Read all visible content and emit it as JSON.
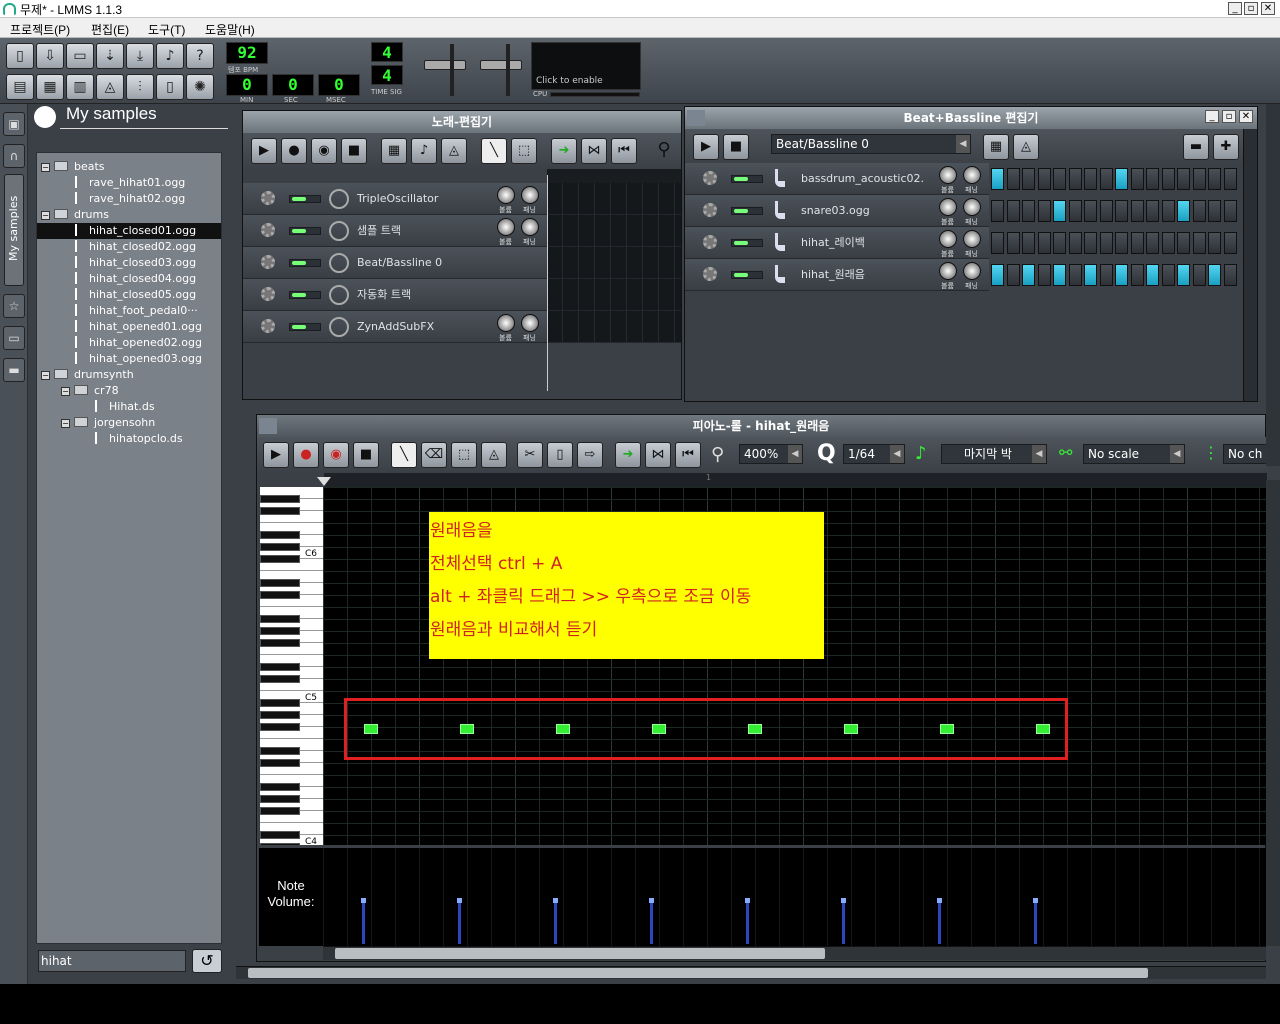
{
  "window": {
    "title": "무제* - LMMS 1.1.3",
    "min": "_",
    "max": "▫",
    "close": "✕"
  },
  "menu": [
    "프로젝트(P)",
    "편집(E)",
    "도구(T)",
    "도움말(H)"
  ],
  "toolbar": {
    "tempo": "92",
    "tempo_label": "템포 BPM",
    "min": "0",
    "sec": "0",
    "msec": "0",
    "min_label": "MIN",
    "sec_label": "SEC",
    "msec_label": "MSEC",
    "sig_num": "4",
    "sig_den": "4",
    "sig_label": "TIME SIG",
    "cpu_hint": "Click to enable",
    "cpu_label": "CPU"
  },
  "browser": {
    "title": "My samples",
    "side_tab_label": "My samples",
    "search_value": "hihat",
    "tree": [
      {
        "label": "beats",
        "type": "folder",
        "depth": 0
      },
      {
        "label": "rave_hihat01.ogg",
        "type": "file",
        "depth": 1
      },
      {
        "label": "rave_hihat02.ogg",
        "type": "file",
        "depth": 1
      },
      {
        "label": "drums",
        "type": "folder",
        "depth": 0
      },
      {
        "label": "hihat_closed01.ogg",
        "type": "file",
        "depth": 1,
        "selected": true
      },
      {
        "label": "hihat_closed02.ogg",
        "type": "file",
        "depth": 1
      },
      {
        "label": "hihat_closed03.ogg",
        "type": "file",
        "depth": 1
      },
      {
        "label": "hihat_closed04.ogg",
        "type": "file",
        "depth": 1
      },
      {
        "label": "hihat_closed05.ogg",
        "type": "file",
        "depth": 1
      },
      {
        "label": "hihat_foot_pedal0···",
        "type": "file",
        "depth": 1
      },
      {
        "label": "hihat_opened01.ogg",
        "type": "file",
        "depth": 1
      },
      {
        "label": "hihat_opened02.ogg",
        "type": "file",
        "depth": 1
      },
      {
        "label": "hihat_opened03.ogg",
        "type": "file",
        "depth": 1
      },
      {
        "label": "drumsynth",
        "type": "folder",
        "depth": 0
      },
      {
        "label": "cr78",
        "type": "folder",
        "depth": 1
      },
      {
        "label": "Hihat.ds",
        "type": "file",
        "depth": 2
      },
      {
        "label": "jorgensohn",
        "type": "folder",
        "depth": 1
      },
      {
        "label": "hihatopclo.ds",
        "type": "file",
        "depth": 2
      }
    ]
  },
  "song_editor": {
    "title": "노래-편집기",
    "tracks": [
      {
        "name": "TripleOscillator",
        "knobs": true
      },
      {
        "name": "샘플 트랙",
        "knobs": true
      },
      {
        "name": "Beat/Bassline 0",
        "knobs": false
      },
      {
        "name": "자동화 트랙",
        "knobs": false
      },
      {
        "name": "ZynAddSubFX",
        "knobs": true
      }
    ],
    "knob_labels": [
      "볼륨",
      "패닝"
    ]
  },
  "bb_editor": {
    "title": "Beat+Bassline 편집기",
    "selector": "Beat/Bassline 0",
    "tracks": [
      {
        "name": "bassdrum_acoustic02.",
        "steps": [
          1,
          0,
          0,
          0,
          0,
          0,
          0,
          0,
          1,
          0,
          0,
          0,
          0,
          0,
          0,
          0
        ]
      },
      {
        "name": "snare03.ogg",
        "steps": [
          0,
          0,
          0,
          0,
          1,
          0,
          0,
          0,
          0,
          0,
          0,
          0,
          1,
          0,
          0,
          0
        ]
      },
      {
        "name": "hihat_레이백",
        "steps": [
          0,
          0,
          0,
          0,
          0,
          0,
          0,
          0,
          0,
          0,
          0,
          0,
          0,
          0,
          0,
          0
        ]
      },
      {
        "name": "hihat_원래음",
        "steps": [
          1,
          0,
          1,
          0,
          1,
          0,
          1,
          0,
          1,
          0,
          1,
          0,
          1,
          0,
          1,
          0
        ]
      }
    ]
  },
  "piano_roll": {
    "title": "피아노-롤 - hihat_원래음",
    "zoom": "400%",
    "quant_icon": "Q",
    "quant": "1/64",
    "note_len": "마지막 박",
    "scale": "No scale",
    "chord": "No ch",
    "key_labels": [
      "C6",
      "C5",
      "C4"
    ],
    "bar_marker": "1",
    "volume_label": "Note Volume:",
    "annotation": {
      "lines": [
        "원래음을",
        "전체선택 ctrl + A",
        "alt + 좌클릭 드래그 >> 우측으로 조금 이동",
        "원래음과 비교해서 듣기"
      ],
      "bg": "#ffff00",
      "text_color": "#d12020"
    },
    "note_count": 8,
    "note_velocity_pct": [
      100,
      100,
      100,
      100,
      100,
      100,
      100,
      100
    ]
  },
  "colors": {
    "accent_green": "#33ee33",
    "step_on": "#29bfe0",
    "selection_box": "#e02020"
  }
}
